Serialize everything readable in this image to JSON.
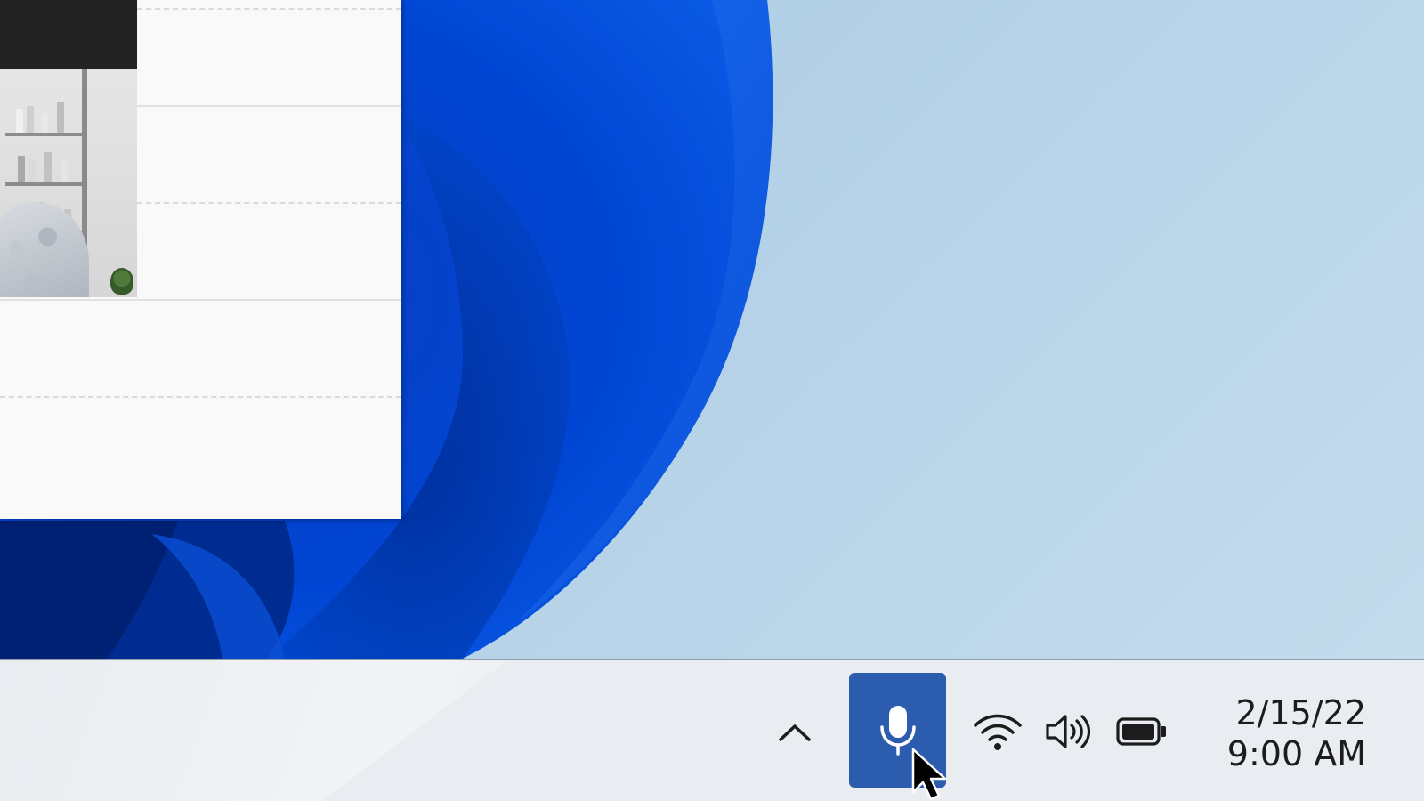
{
  "desktop": {
    "wallpaper": "windows-11-bloom",
    "colors": {
      "background": "#b4d2e7",
      "bloom_dark": "#0033a8",
      "bloom_mid": "#0047cf",
      "bloom_light": "#1565e6"
    }
  },
  "app_window": {
    "video_tile": "participant-video",
    "rows": 4
  },
  "taskbar": {
    "tray": {
      "show_hidden_icons": {
        "icon": "chevron-up-icon"
      },
      "microphone": {
        "icon": "microphone-icon",
        "state": "active",
        "color": "#2b5cad"
      },
      "network": {
        "icon": "wifi-icon"
      },
      "volume": {
        "icon": "speaker-icon"
      },
      "battery": {
        "icon": "battery-icon"
      }
    },
    "clock": {
      "date": "2/15/22",
      "time": "9:00 AM"
    }
  },
  "cursor": {
    "icon": "arrow-cursor-icon"
  }
}
